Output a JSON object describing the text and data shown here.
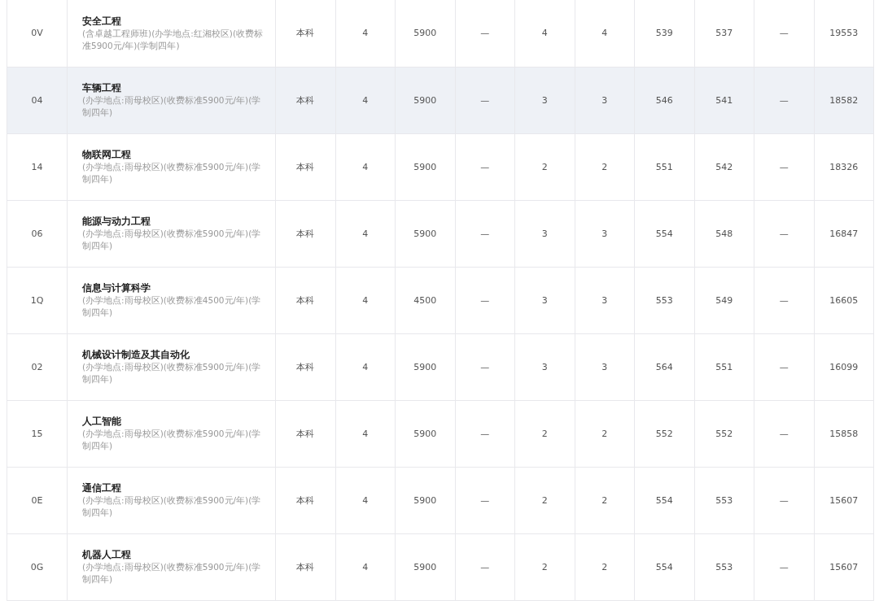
{
  "table": {
    "rows": [
      {
        "selected": false,
        "code": "0V",
        "major": "安全工程",
        "note": "(含卓越工程师班)(办学地点:红湘校区)(收费标准5900元/年)(学制四年)",
        "cells": [
          "本科",
          "4",
          "5900",
          "—",
          "4",
          "4",
          "539",
          "537",
          "—",
          "19553"
        ]
      },
      {
        "selected": true,
        "code": "04",
        "major": "车辆工程",
        "note": "(办学地点:雨母校区)(收费标准5900元/年)(学制四年)",
        "cells": [
          "本科",
          "4",
          "5900",
          "—",
          "3",
          "3",
          "546",
          "541",
          "—",
          "18582"
        ]
      },
      {
        "selected": false,
        "code": "14",
        "major": "物联网工程",
        "note": "(办学地点:雨母校区)(收费标准5900元/年)(学制四年)",
        "cells": [
          "本科",
          "4",
          "5900",
          "—",
          "2",
          "2",
          "551",
          "542",
          "—",
          "18326"
        ]
      },
      {
        "selected": false,
        "code": "06",
        "major": "能源与动力工程",
        "note": "(办学地点:雨母校区)(收费标准5900元/年)(学制四年)",
        "cells": [
          "本科",
          "4",
          "5900",
          "—",
          "3",
          "3",
          "554",
          "548",
          "—",
          "16847"
        ]
      },
      {
        "selected": false,
        "code": "1Q",
        "major": "信息与计算科学",
        "note": "(办学地点:雨母校区)(收费标准4500元/年)(学制四年)",
        "cells": [
          "本科",
          "4",
          "4500",
          "—",
          "3",
          "3",
          "553",
          "549",
          "—",
          "16605"
        ]
      },
      {
        "selected": false,
        "code": "02",
        "major": "机械设计制造及其自动化",
        "note": "(办学地点:雨母校区)(收费标准5900元/年)(学制四年)",
        "cells": [
          "本科",
          "4",
          "5900",
          "—",
          "3",
          "3",
          "564",
          "551",
          "—",
          "16099"
        ]
      },
      {
        "selected": false,
        "code": "15",
        "major": "人工智能",
        "note": "(办学地点:雨母校区)(收费标准5900元/年)(学制四年)",
        "cells": [
          "本科",
          "4",
          "5900",
          "—",
          "2",
          "2",
          "552",
          "552",
          "—",
          "15858"
        ]
      },
      {
        "selected": false,
        "code": "0E",
        "major": "通信工程",
        "note": "(办学地点:雨母校区)(收费标准5900元/年)(学制四年)",
        "cells": [
          "本科",
          "4",
          "5900",
          "—",
          "2",
          "2",
          "554",
          "553",
          "—",
          "15607"
        ]
      },
      {
        "selected": false,
        "code": "0G",
        "major": "机器人工程",
        "note": "(办学地点:雨母校区)(收费标准5900元/年)(学制四年)",
        "cells": [
          "本科",
          "4",
          "5900",
          "—",
          "2",
          "2",
          "554",
          "553",
          "—",
          "15607"
        ]
      }
    ]
  }
}
